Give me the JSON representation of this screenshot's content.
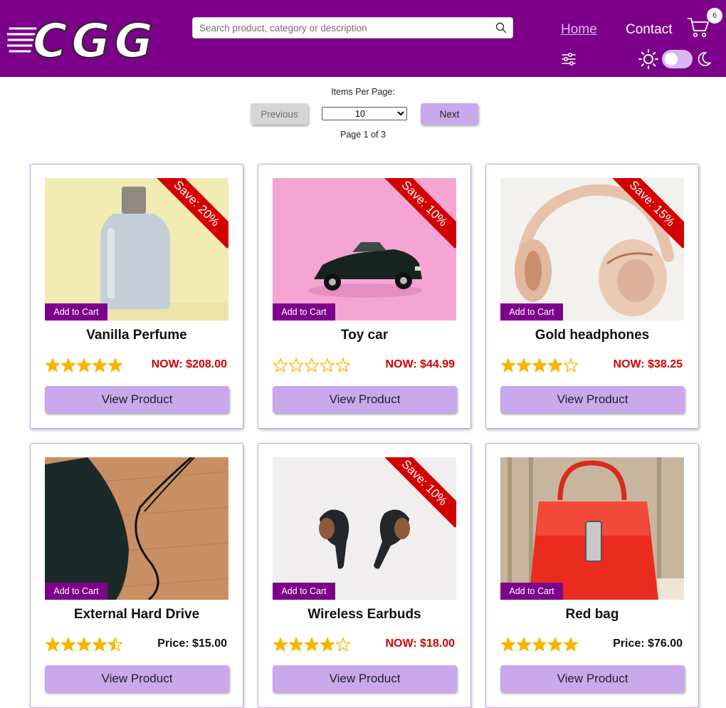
{
  "header": {
    "logo_text": "CGG",
    "search_placeholder": "Search product, category or description",
    "nav": {
      "home": "Home",
      "contact": "Contact"
    },
    "cart_count": "6",
    "brand_color": "#7d008a",
    "accent_color": "#caa8ec"
  },
  "pagination": {
    "items_per_page_label": "Items Per Page:",
    "previous_label": "Previous",
    "next_label": "Next",
    "items_per_page": "10",
    "page_info": "Page 1 of 3"
  },
  "add_to_cart_label": "Add to Cart",
  "view_product_label": "View Product",
  "products": [
    {
      "name": "Vanilla Perfume",
      "save": "Save: 20%",
      "price": "NOW: $208.00",
      "price_kind": "sale",
      "rating": 5,
      "image": "perfume-bottle"
    },
    {
      "name": "Toy car",
      "save": "Save: 10%",
      "price": "NOW: $44.99",
      "price_kind": "sale",
      "rating": 0,
      "image": "toy-car"
    },
    {
      "name": "Gold headphones",
      "save": "Save: 15%",
      "price": "NOW: $38.25",
      "price_kind": "sale",
      "rating": 4,
      "image": "headphones"
    },
    {
      "name": "External Hard Drive",
      "save": "",
      "price": "Price: $15.00",
      "price_kind": "regular",
      "rating": 4.5,
      "image": "hard-drive"
    },
    {
      "name": "Wireless Earbuds",
      "save": "Save: 10%",
      "price": "NOW: $18.00",
      "price_kind": "sale",
      "rating": 4,
      "image": "earbuds"
    },
    {
      "name": "Red bag",
      "save": "",
      "price": "Price: $76.00",
      "price_kind": "regular",
      "rating": 5,
      "image": "handbag"
    }
  ]
}
